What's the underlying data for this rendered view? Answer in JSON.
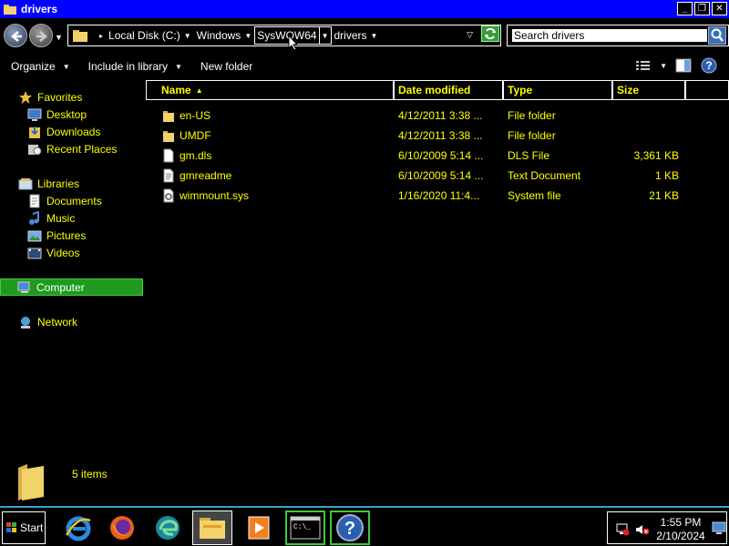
{
  "window": {
    "title": "drivers"
  },
  "address": {
    "crumbs": [
      {
        "label": "Local Disk (C:)"
      },
      {
        "label": "Windows"
      },
      {
        "label": "SysWOW64"
      },
      {
        "label": "drivers"
      }
    ]
  },
  "search": {
    "placeholder": "Search drivers"
  },
  "toolbar": {
    "organize": "Organize",
    "include_in_library": "Include in library",
    "new_folder": "New folder"
  },
  "nav": {
    "favorites": "Favorites",
    "desktop": "Desktop",
    "downloads": "Downloads",
    "recent_places": "Recent Places",
    "libraries": "Libraries",
    "documents": "Documents",
    "music": "Music",
    "pictures": "Pictures",
    "videos": "Videos",
    "computer": "Computer",
    "network": "Network"
  },
  "columns": {
    "name": "Name",
    "date": "Date modified",
    "type": "Type",
    "size": "Size"
  },
  "files": [
    {
      "name": "en-US",
      "date": "4/12/2011 3:38 ...",
      "type": "File folder",
      "size": "",
      "icon": "folder-icon"
    },
    {
      "name": "UMDF",
      "date": "4/12/2011 3:38 ...",
      "type": "File folder",
      "size": "",
      "icon": "folder-icon"
    },
    {
      "name": "gm.dls",
      "date": "6/10/2009 5:14 ...",
      "type": "DLS File",
      "size": "3,361 KB",
      "icon": "file-icon"
    },
    {
      "name": "gmreadme",
      "date": "6/10/2009 5:14 ...",
      "type": "Text Document",
      "size": "1 KB",
      "icon": "text-file-icon"
    },
    {
      "name": "wimmount.sys",
      "date": "1/16/2020 11:4...",
      "type": "System file",
      "size": "21 KB",
      "icon": "system-file-icon"
    }
  ],
  "details": {
    "count": "5 items"
  },
  "taskbar": {
    "start": "Start",
    "time": "1:55 PM",
    "date": "2/10/2024"
  },
  "colors": {
    "text": "#ffff00",
    "titlebar": "#0000ff",
    "selected": "#1f9a1f"
  }
}
